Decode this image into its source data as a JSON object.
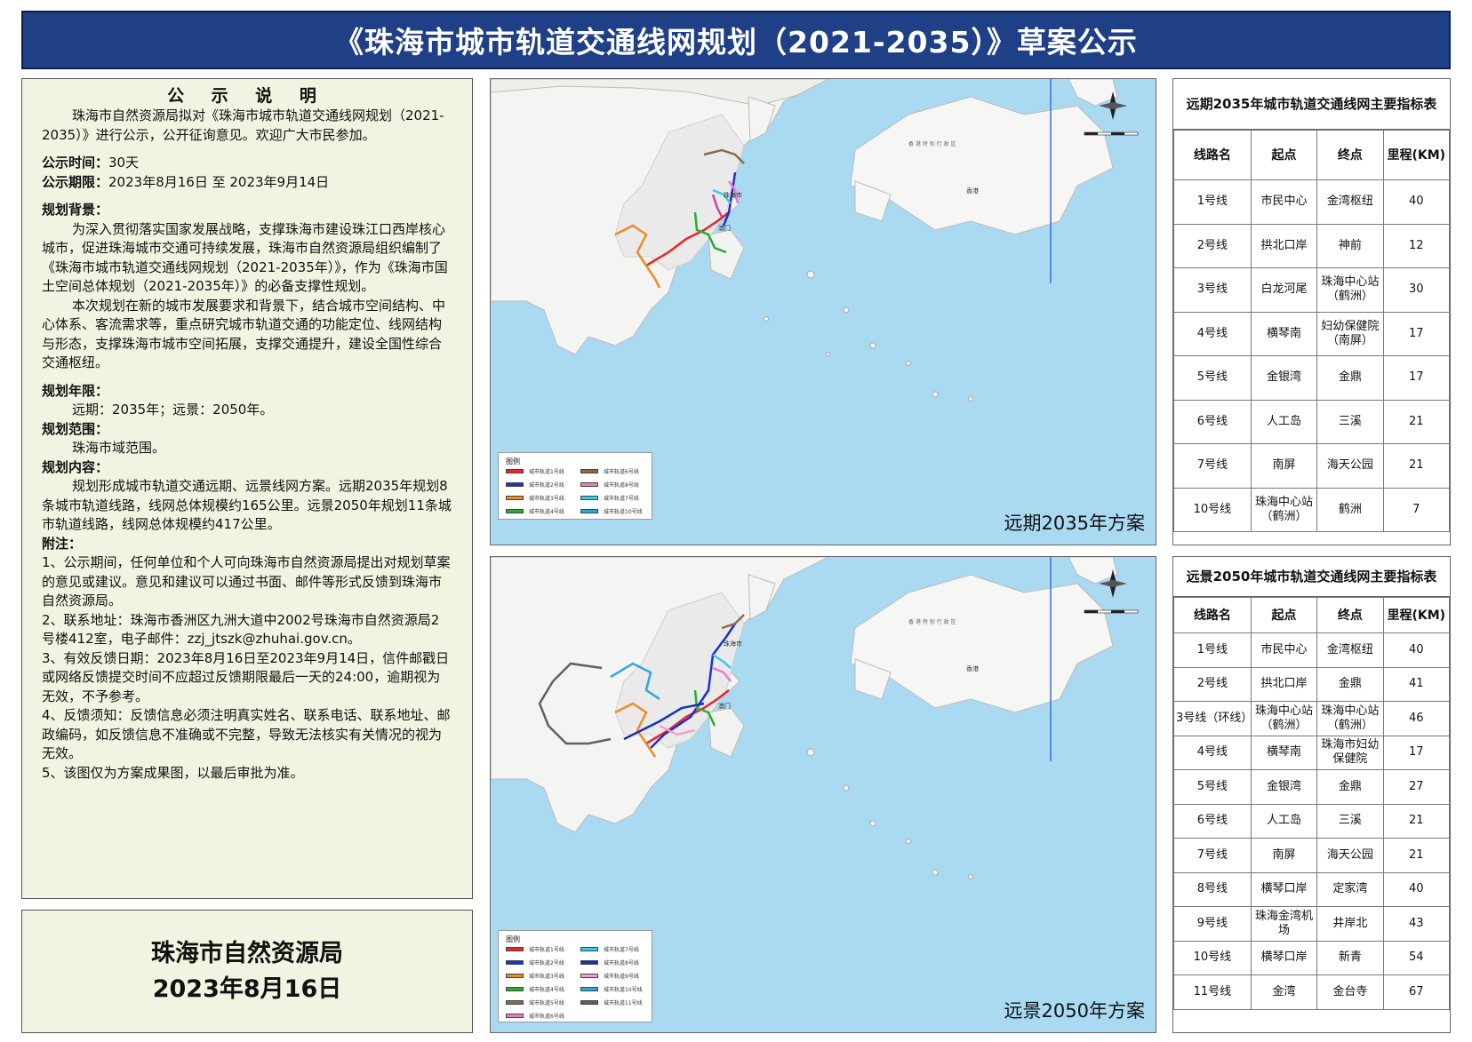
{
  "header": {
    "title": "《珠海市城市轨道交通线网规划（2021-2035）》草案公示"
  },
  "notice": {
    "heading": "公 示 说 明",
    "intro": "珠海市自然资源局拟对《珠海市城市轨道交通线网规划（2021-2035）》进行公示，公开征询意见。欢迎广大市民参加。",
    "time_label": "公示时间：",
    "time_value": "30天",
    "period_label": "公示期限：",
    "period_value": "2023年8月16日 至 2023年9月14日",
    "bg_title": "规划背景：",
    "bg_p1": "为深入贯彻落实国家发展战略，支撑珠海市建设珠江口西岸核心城市，促进珠海城市交通可持续发展，珠海市自然资源局组织编制了《珠海市城市轨道交通线网规划（2021-2035年）》，作为《珠海市国土空间总体规划（2021-2035年）》的必备支撑性规划。",
    "bg_p2": "本次规划在新的城市发展要求和背景下，结合城市空间结构、中心体系、客流需求等，重点研究城市轨道交通的功能定位、线网结构与形态，支撑珠海市城市空间拓展，支撑交通提升，建设全国性综合交通枢纽。",
    "years_title": "规划年限：",
    "years_value": "远期：2035年；远景：2050年。",
    "scope_title": "规划范围：",
    "scope_value": "珠海市域范围。",
    "content_title": "规划内容：",
    "content_value": "规划形成城市轨道交通远期、远景线网方案。远期2035年规划8条城市轨道线路，线网总体规模约165公里。远景2050年规划11条城市轨道线路，线网总体规模约417公里。",
    "notes_title": "附注：",
    "notes": [
      "1、公示期间，任何单位和个人可向珠海市自然资源局提出对规划草案的意见或建议。意见和建议可以通过书面、邮件等形式反馈到珠海市自然资源局。",
      "2、联系地址：珠海市香洲区九洲大道中2002号珠海市自然资源局2号楼412室，电子邮件：zzj_jtszk@zhuhai.gov.cn。",
      "3、有效反馈日期：2023年8月16日至2023年9月14日，信件邮戳日或网络反馈提交时间不应超过反馈期限最后一天的24:00，逾期视为无效，不予参考。",
      "4、反馈须知：反馈信息必须注明真实姓名、联系电话、联系地址、邮政编码，如反馈信息不准确或不完整，导致无法核实有关情况的视为无效。",
      "5、该图仅为方案成果图，以最后审批为准。"
    ]
  },
  "signature": {
    "org": "珠海市自然资源局",
    "date": "2023年8月16日"
  },
  "map2035": {
    "caption": "远期2035年方案",
    "legend_title": "图例",
    "legend": [
      {
        "label": "城市轨道1号线",
        "color": "#e8262a"
      },
      {
        "label": "城市轨道6号线",
        "color": "#8b6b4a"
      },
      {
        "label": "城市轨道2号线",
        "color": "#1c2fd8"
      },
      {
        "label": "城市轨道8号线",
        "color": "#f07ac8"
      },
      {
        "label": "城市轨道3号线",
        "color": "#f08a24"
      },
      {
        "label": "城市轨道7号线",
        "color": "#2fd0e8"
      },
      {
        "label": "城市轨道4号线",
        "color": "#22b034"
      },
      {
        "label": "城市轨道10号线",
        "color": "#2aa8e0"
      }
    ],
    "labels": {
      "city": "珠海市",
      "macau": "澳门",
      "hk": "香港",
      "hk_sea": "香 港 特 别 行 政 区"
    }
  },
  "map2050": {
    "caption": "远景2050年方案",
    "legend_title": "图例",
    "legend": [
      {
        "label": "城市轨道1号线",
        "color": "#e8262a"
      },
      {
        "label": "城市轨道7号线",
        "color": "#2fd0e8"
      },
      {
        "label": "城市轨道2号线",
        "color": "#1c2fd8"
      },
      {
        "label": "城市轨道8号线",
        "color": "#1530c0"
      },
      {
        "label": "城市轨道3号线",
        "color": "#f08a24"
      },
      {
        "label": "城市轨道9号线",
        "color": "#f2a0d0"
      },
      {
        "label": "城市轨道4号线",
        "color": "#22b034"
      },
      {
        "label": "城市轨道10号线",
        "color": "#2aa8e0"
      },
      {
        "label": "城市轨道5号线",
        "color": "#8b6b4a"
      },
      {
        "label": "城市轨道11号线",
        "color": "#606060"
      },
      {
        "label": "城市轨道6号线",
        "color": "#f07ac8"
      }
    ],
    "labels": {
      "city": "珠海市",
      "macau": "澳门",
      "hk": "香港",
      "hk_sea": "香 港 特 别 行 政 区"
    }
  },
  "table2035": {
    "title": "远期2035年城市轨道交通线网主要指标表",
    "headers": [
      "线路名",
      "起点",
      "终点",
      "里程(KM)"
    ],
    "rows": [
      [
        "1号线",
        "市民中心",
        "金湾枢纽",
        "40"
      ],
      [
        "2号线",
        "拱北口岸",
        "神前",
        "12"
      ],
      [
        "3号线",
        "白龙河尾",
        "珠海中心站（鹤洲）",
        "30"
      ],
      [
        "4号线",
        "横琴南",
        "妇幼保健院（南屏）",
        "17"
      ],
      [
        "5号线",
        "金银湾",
        "金鼎",
        "17"
      ],
      [
        "6号线",
        "人工岛",
        "三溪",
        "21"
      ],
      [
        "7号线",
        "南屏",
        "海天公园",
        "21"
      ],
      [
        "10号线",
        "珠海中心站（鹤洲）",
        "鹤洲",
        "7"
      ]
    ]
  },
  "table2050": {
    "title": "远景2050年城市轨道交通线网主要指标表",
    "headers": [
      "线路名",
      "起点",
      "终点",
      "里程(KM)"
    ],
    "rows": [
      [
        "1号线",
        "市民中心",
        "金湾枢纽",
        "40"
      ],
      [
        "2号线",
        "拱北口岸",
        "金鼎",
        "41"
      ],
      [
        "3号线（环线）",
        "珠海中心站（鹤洲）",
        "珠海中心站（鹤洲）",
        "46"
      ],
      [
        "4号线",
        "横琴南",
        "珠海市妇幼保健院",
        "17"
      ],
      [
        "5号线",
        "金银湾",
        "金鼎",
        "27"
      ],
      [
        "6号线",
        "人工岛",
        "三溪",
        "21"
      ],
      [
        "7号线",
        "南屏",
        "海天公园",
        "21"
      ],
      [
        "8号线",
        "横琴口岸",
        "定家湾",
        "40"
      ],
      [
        "9号线",
        "珠海金湾机场",
        "井岸北",
        "43"
      ],
      [
        "10号线",
        "横琴口岸",
        "新青",
        "54"
      ],
      [
        "11号线",
        "金湾",
        "金台寺",
        "67"
      ]
    ]
  }
}
